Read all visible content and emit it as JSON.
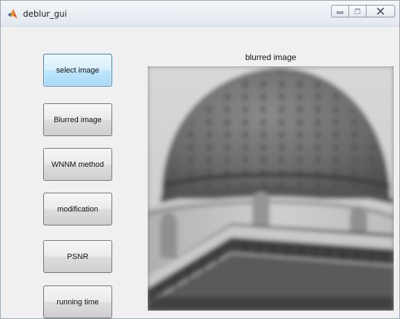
{
  "window": {
    "title": "deblur_gui",
    "icon": "matlab-icon"
  },
  "title_controls": {
    "minimize_icon": "minimize-icon",
    "maximize_icon": "maximize-icon",
    "close_icon": "close-icon"
  },
  "buttons": {
    "select_image": "select image",
    "blurred_image": "Blurred image",
    "wnnm_method": "WNNM method",
    "modification": "modification",
    "psnr": "PSNR",
    "running_time": "running time"
  },
  "axes": {
    "title": "blurred image"
  }
}
